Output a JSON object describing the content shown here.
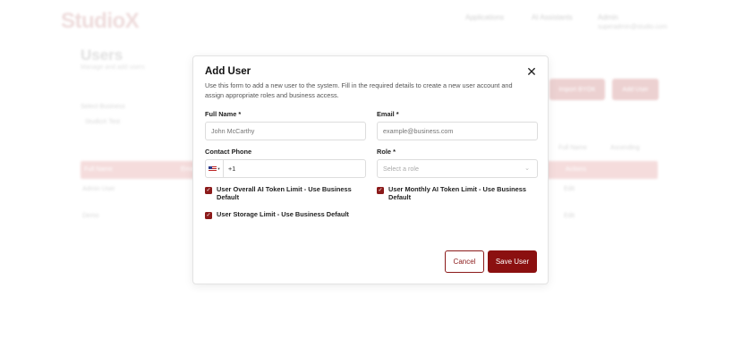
{
  "background": {
    "logo_main": "Studio",
    "logo_accent": "X",
    "nav_items": [
      "Applications",
      "AI Assistants",
      "Admin"
    ],
    "nav_user_email": "superadmin@studio.com",
    "page_title": "Users",
    "page_subtitle": "Manage and add users",
    "import_button": "Import BYOK",
    "add_user_button": "Add User",
    "filter_label": "Select Business",
    "filter_value": "StudioX Test",
    "sort_label": "Full Name",
    "sort_order": "Ascending",
    "table_headers": [
      "Full Name",
      "Email",
      "Actions"
    ],
    "rows": [
      [
        "Admin User",
        "Edit"
      ],
      [
        "Demo",
        "Edit"
      ]
    ]
  },
  "modal": {
    "title": "Add User",
    "description": "Use this form to add a new user to the system. Fill in the required details to create a new user account and assign appropriate roles and business access.",
    "fields": {
      "full_name": {
        "label": "Full Name *",
        "placeholder": "John McCarthy"
      },
      "email": {
        "label": "Email *",
        "placeholder": "example@business.com"
      },
      "phone": {
        "label": "Contact Phone",
        "code": "+1"
      },
      "role": {
        "label": "Role *",
        "placeholder": "Select a role"
      }
    },
    "checkboxes": {
      "ai_token_limit": "User Overall AI Token Limit - Use Business Default",
      "monthly_token_limit": "User Monthly AI Token Limit - Use Business Default",
      "storage_limit": "User Storage Limit - Use Business Default"
    },
    "cancel_label": "Cancel",
    "save_label": "Save User"
  }
}
